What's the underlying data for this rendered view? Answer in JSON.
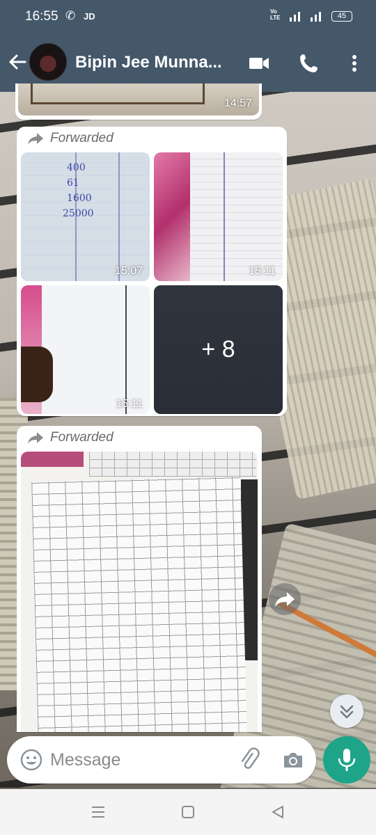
{
  "status_bar": {
    "time": "16:55",
    "carrier_tag": "JD",
    "network": "VoLTE",
    "battery": "45"
  },
  "header": {
    "contact_name": "Bipin Jee Munna...",
    "icons": [
      "back-arrow-icon",
      "video-call-icon",
      "voice-call-icon",
      "more-vert-icon"
    ],
    "bg_color": "#44586a"
  },
  "messages": {
    "top_image_time": "14:57",
    "album": {
      "forwarded_label": "Forwarded",
      "tiles": [
        {
          "time": "15:07",
          "ink": [
            "400",
            "61",
            "1600",
            "25000"
          ]
        },
        {
          "time": "15:11"
        },
        {
          "time": "15:11"
        },
        {
          "more_label": "+ 8"
        }
      ]
    },
    "sheet": {
      "forwarded_label": "Forwarded"
    }
  },
  "input": {
    "placeholder": "Message",
    "accent": "#1ea589"
  },
  "nav_bar": {
    "icons": [
      "recents-icon",
      "home-icon",
      "back-icon"
    ]
  }
}
